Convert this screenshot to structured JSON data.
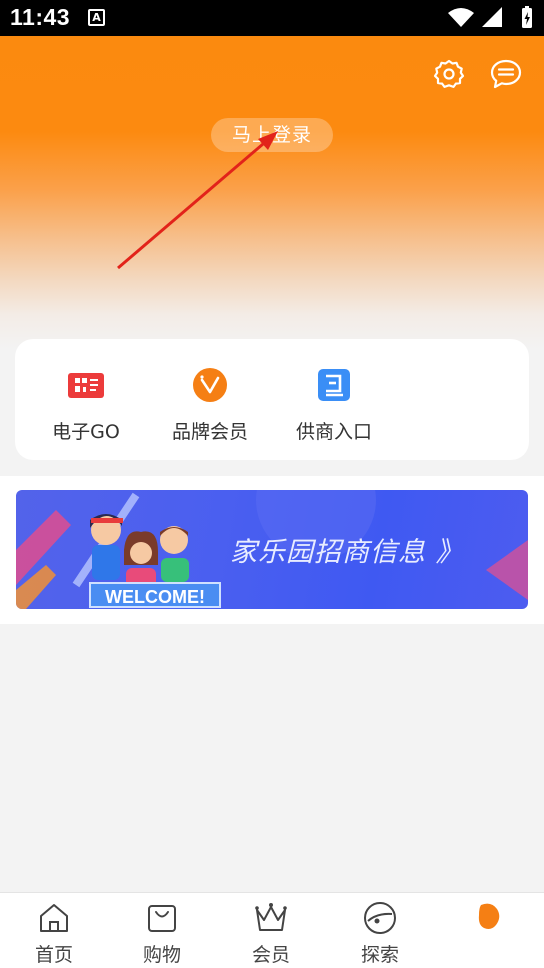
{
  "status_bar": {
    "time": "11:43",
    "notification_glyph": "A"
  },
  "header": {
    "login_label": "马上登录",
    "colors": {
      "accent": "#fb8a0f"
    }
  },
  "quick_actions": [
    {
      "label": "电子GO",
      "icon": "qr-card-icon",
      "color": "#ec3b3b"
    },
    {
      "label": "品牌会员",
      "icon": "vip-badge-icon",
      "color": "#f57f14"
    },
    {
      "label": "供商入口",
      "icon": "supplier-entry-icon",
      "color": "#3a8ef6"
    }
  ],
  "banner": {
    "text": "家乐园招商信息 》",
    "welcome": "WELCOME!"
  },
  "tabbar": {
    "items": [
      {
        "label": "首页",
        "icon": "home-icon"
      },
      {
        "label": "购物",
        "icon": "shopping-bag-icon"
      },
      {
        "label": "会员",
        "icon": "crown-icon"
      },
      {
        "label": "探索",
        "icon": "explore-icon"
      },
      {
        "label": "",
        "icon": "profile-active-icon"
      }
    ]
  }
}
